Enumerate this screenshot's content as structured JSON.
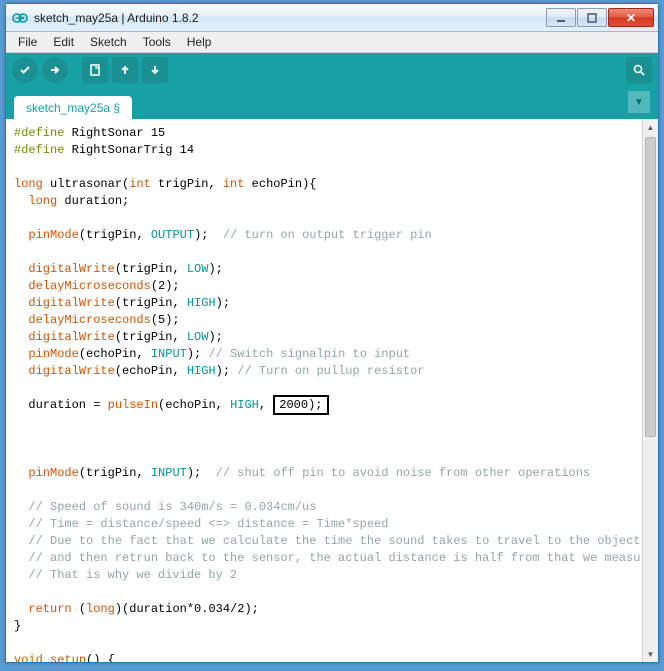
{
  "window": {
    "title": "sketch_may25a | Arduino 1.8.2"
  },
  "menu": {
    "file": "File",
    "edit": "Edit",
    "sketch": "Sketch",
    "tools": "Tools",
    "help": "Help"
  },
  "tabs": {
    "main": "sketch_may25a §"
  },
  "code": {
    "l1a": "#define",
    "l1b": " RightSonar 15",
    "l2a": "#define",
    "l2b": " RightSonarTrig 14",
    "l3_blank": "",
    "l4a": "long",
    "l4b": " ultrasonar(",
    "l4c": "int",
    "l4d": " trigPin, ",
    "l4e": "int",
    "l4f": " echoPin){",
    "l5a": "  ",
    "l5b": "long",
    "l5c": " duration;",
    "l6_blank": "  ",
    "l7a": "  ",
    "l7b": "pinMode",
    "l7c": "(trigPin, ",
    "l7d": "OUTPUT",
    "l7e": ");  ",
    "l7f": "// turn on output trigger pin",
    "l8_blank": "",
    "l9a": "  ",
    "l9b": "digitalWrite",
    "l9c": "(trigPin, ",
    "l9d": "LOW",
    "l9e": ");",
    "l10a": "  ",
    "l10b": "delayMicroseconds",
    "l10c": "(2);",
    "l11a": "  ",
    "l11b": "digitalWrite",
    "l11c": "(trigPin, ",
    "l11d": "HIGH",
    "l11e": ");",
    "l12a": "  ",
    "l12b": "delayMicroseconds",
    "l12c": "(5);",
    "l13a": "  ",
    "l13b": "digitalWrite",
    "l13c": "(trigPin, ",
    "l13d": "LOW",
    "l13e": ");",
    "l14a": "  ",
    "l14b": "pinMode",
    "l14c": "(echoPin, ",
    "l14d": "INPUT",
    "l14e": "); ",
    "l14f": "// Switch signalpin to input",
    "l15a": "  ",
    "l15b": "digitalWrite",
    "l15c": "(echoPin, ",
    "l15d": "HIGH",
    "l15e": "); ",
    "l15f": "// Turn on pullup resistor",
    "l16_blank": "",
    "l17a": "  duration = ",
    "l17b": "pulseIn",
    "l17c": "(echoPin, ",
    "l17d": "HIGH",
    "l17e": ", ",
    "l17f": "2000);",
    "l18_blank": "",
    "l19_blank": "",
    "l20_blank": "",
    "l21a": "  ",
    "l21b": "pinMode",
    "l21c": "(trigPin, ",
    "l21d": "INPUT",
    "l21e": ");  ",
    "l21f": "// shut off pin to avoid noise from other operations",
    "l22_blank": "",
    "l23a": "  ",
    "l23b": "// Speed of sound is 340m/s = 0.034cm/us",
    "l24a": "  ",
    "l24b": "// Time = distance/speed <=> distance = Time*speed",
    "l25a": "  ",
    "l25b": "// Due to the fact that we calculate the time the sound takes to travel to the object",
    "l26a": "  ",
    "l26b": "// and then retrun back to the sensor, the actual distance is half from that we measure",
    "l27a": "  ",
    "l27b": "// That is why we divide by 2",
    "l28_blank": "",
    "l29a": "  ",
    "l29b": "return",
    "l29c": " (",
    "l29d": "long",
    "l29e": ")(duration*0.034/2);",
    "l30": "}",
    "l31_blank": "",
    "l32a": "void",
    "l32b": " ",
    "l32c": "setup",
    "l32d": "() {"
  }
}
